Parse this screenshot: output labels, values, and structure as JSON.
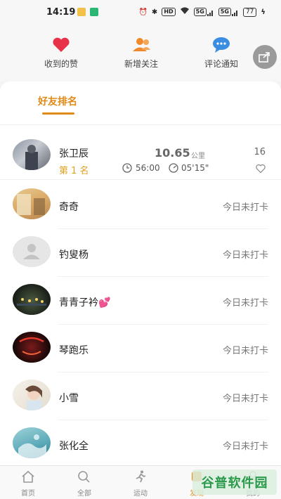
{
  "status_bar": {
    "time": "14:19",
    "hd_label": "HD",
    "signal_label_1": "5G",
    "signal_label_2": "5G",
    "battery": "77"
  },
  "header": {
    "actions": [
      {
        "label": "收到的赞",
        "icon": "heart-icon",
        "color": "#e8324a"
      },
      {
        "label": "新增关注",
        "icon": "add-user-icon",
        "color": "#f0892a"
      },
      {
        "label": "评论通知",
        "icon": "comment-icon",
        "color": "#3a8de0"
      }
    ],
    "share_icon": "share-icon"
  },
  "tabs": {
    "active_label": "好友排名"
  },
  "ranking": {
    "top": {
      "name": "张卫辰",
      "rank": "第 1 名",
      "distance": "10.65",
      "unit": "公里",
      "duration": "56:00",
      "pace": "05'15\"",
      "likes": "16"
    },
    "friends": [
      {
        "name": "奇奇",
        "status": "今日未打卡"
      },
      {
        "name": "钓叟杨",
        "status": "今日未打卡"
      },
      {
        "name": "青青子衿💕",
        "status": "今日未打卡"
      },
      {
        "name": "琴跑乐",
        "status": "今日未打卡"
      },
      {
        "name": "小雪",
        "status": "今日未打卡"
      },
      {
        "name": "张化全",
        "status": "今日未打卡"
      }
    ]
  },
  "bottom_nav": {
    "items": [
      {
        "label": "首页",
        "icon": "home-icon"
      },
      {
        "label": "全部",
        "icon": "search-icon"
      },
      {
        "label": "运动",
        "icon": "runner-icon"
      },
      {
        "label": "发现",
        "icon": "discover-icon"
      },
      {
        "label": "我的",
        "icon": "profile-icon"
      }
    ],
    "active_index": 3
  },
  "watermark": "谷普软件园",
  "colors": {
    "accent": "#e08a18",
    "rank_gold": "#e0a020",
    "watermark_green": "#2a9a4a"
  }
}
